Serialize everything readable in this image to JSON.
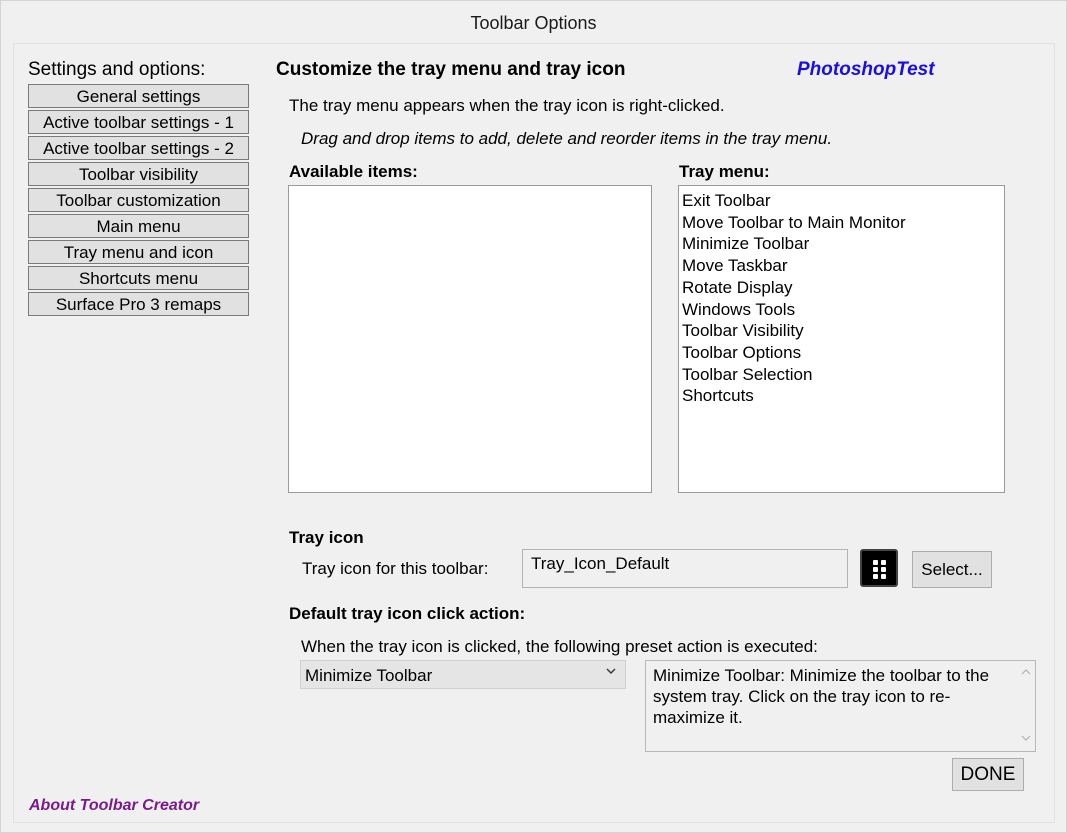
{
  "window": {
    "title": "Toolbar Options"
  },
  "sidebar": {
    "heading": "Settings and options:",
    "items": [
      "General settings",
      "Active toolbar settings - 1",
      "Active toolbar settings - 2",
      "Toolbar visibility",
      "Toolbar customization",
      "Main menu",
      "Tray menu and icon",
      "Shortcuts menu",
      "Surface Pro 3 remaps"
    ]
  },
  "main": {
    "title": "Customize the tray menu and tray icon",
    "brand": "PhotoshopTest",
    "description": "The tray menu appears when the tray icon is right-clicked.",
    "instruction": "Drag and drop items to add, delete and reorder items in the tray menu.",
    "available_label": "Available items:",
    "available_items": [],
    "tray_menu_label": "Tray menu:",
    "tray_menu_items": [
      "Exit Toolbar",
      "Move Toolbar to Main Monitor",
      "Minimize Toolbar",
      "Move Taskbar",
      "Rotate Display",
      "Windows Tools",
      "Toolbar Visibility",
      "Toolbar Options",
      "Toolbar Selection",
      "Shortcuts"
    ]
  },
  "tray_icon": {
    "section_label": "Tray icon",
    "field_label": "Tray icon for this toolbar:",
    "value": "Tray_Icon_Default",
    "preview_icon": "grid-icon",
    "select_button": "Select..."
  },
  "click_action": {
    "section_label": "Default tray icon click action:",
    "description": "When the tray icon is clicked, the following preset action is executed:",
    "selected": "Minimize Toolbar",
    "dropdown_icon": "chevron-down-icon",
    "help_text": "Minimize Toolbar: Minimize the toolbar to the system tray. Click on the tray icon to re-maximize it."
  },
  "footer": {
    "done_button": "DONE",
    "about_link": "About Toolbar Creator"
  },
  "colors": {
    "brand": "#1a0ee6",
    "about_link": "#7a1b8c",
    "window_bg": "#f0f0f0"
  }
}
